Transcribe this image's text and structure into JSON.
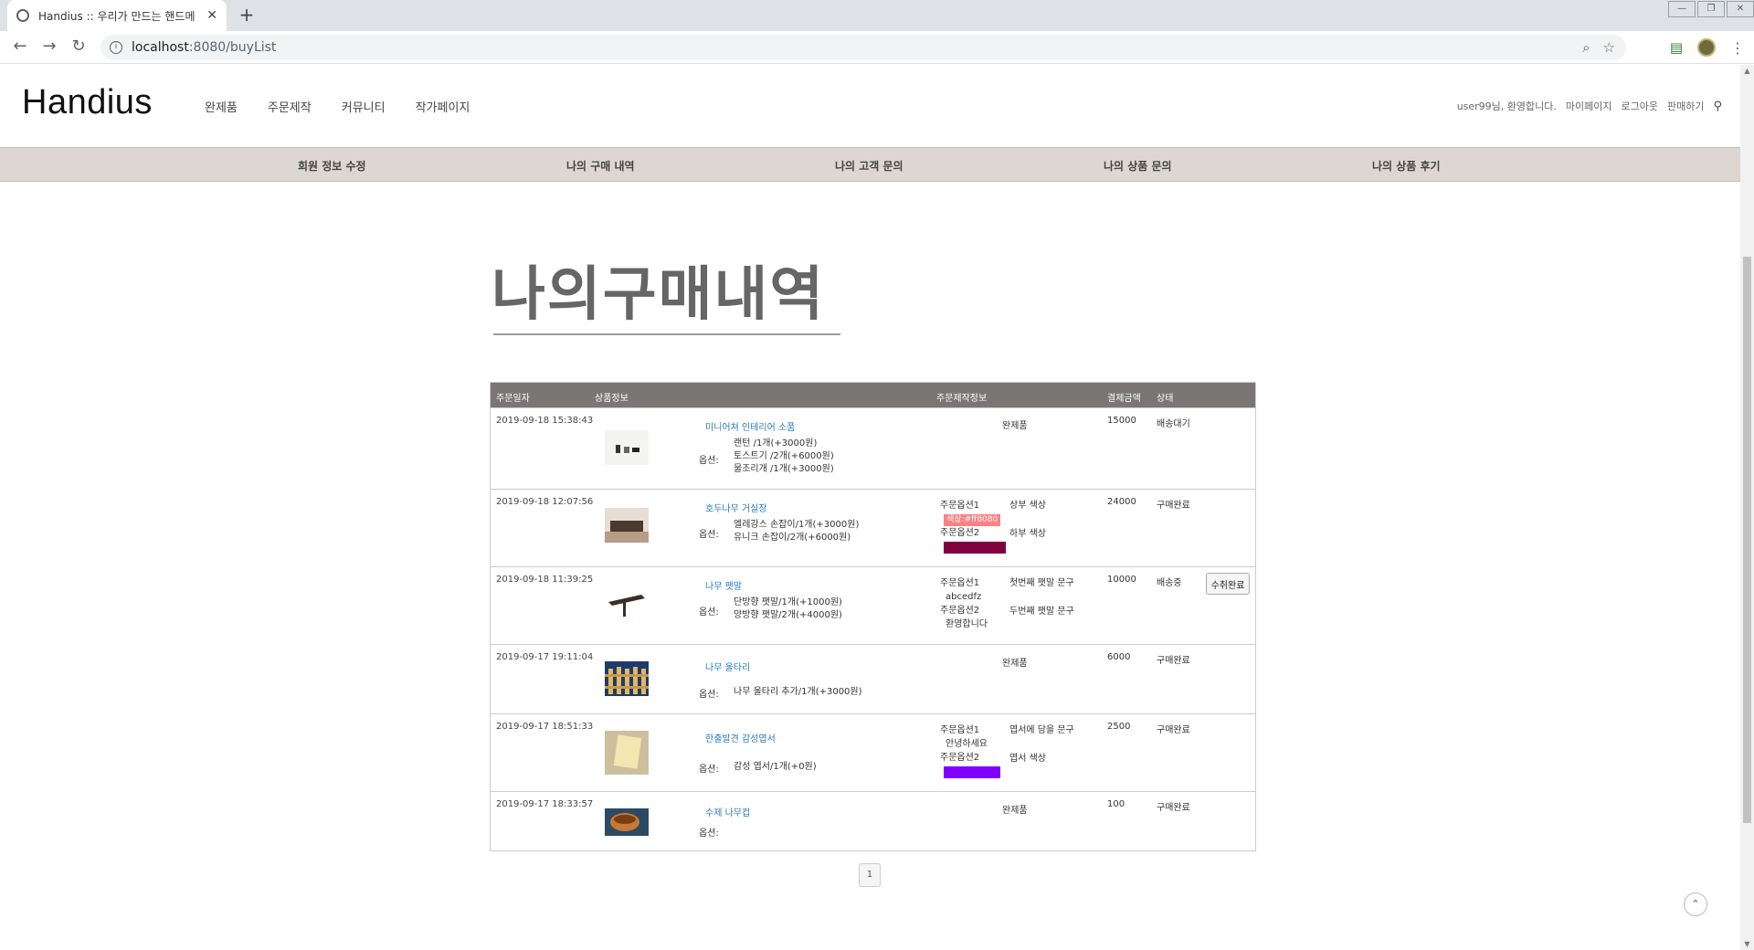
{
  "browser": {
    "tab_title": "Handius :: 우리가 만드는 핸드메",
    "tab_close": "✕",
    "new_tab": "+",
    "url_host": "localhost",
    "url_rest": ":8080/buyList",
    "window_controls": [
      "—",
      "❐",
      "✕"
    ]
  },
  "site": {
    "logo": "Handius",
    "gnb": [
      "완제품",
      "주문제작",
      "커뮤니티",
      "작가페이지"
    ],
    "util": {
      "welcome": "user99님, 환영합니다.",
      "mypage": "마이페이지",
      "logout": "로그아웃",
      "sell": "판매하기"
    },
    "subnav": [
      "회원 정보 수정",
      "나의 구매 내역",
      "나의 고객 문의",
      "나의 상품 문의",
      "나의 상품 후기"
    ]
  },
  "page_title": "나의구매내역",
  "table": {
    "headers": {
      "date": "주문일자",
      "product": "상품정보",
      "custom": "주문제작정보",
      "amount": "결제금액",
      "status": "상태"
    },
    "option_label": "옵션:",
    "rows": [
      {
        "date": "2019-09-18 15:38:43",
        "name": "미니어쳐 인테리어 소품",
        "options": [
          "랜턴 /1개(+3000원)",
          "토스트기 /2개(+6000원)",
          "물조리개 /1개(+3000원)"
        ],
        "custom_text": "완제품",
        "price": "15000",
        "status": "배송대기"
      },
      {
        "date": "2019-09-18 12:07:56",
        "name": "호두나무 거실장",
        "options": [
          "엘레강스 손잡이/1개(+3000원)",
          "유니크 손잡이/2개(+6000원)"
        ],
        "custom": [
          {
            "label": "주문옵션1",
            "value": "색상:#ff8080",
            "swatch": "#ff8080",
            "question": "상부 색상"
          },
          {
            "label": "주문옵션2",
            "value": "색상:#800040",
            "swatch": "#800040",
            "question": "하부 색상"
          }
        ],
        "price": "24000",
        "status": "구매완료"
      },
      {
        "date": "2019-09-18 11:39:25",
        "name": "나무 팻말",
        "options": [
          "단방향 팻말/1개(+1000원)",
          "양방향 팻말/2개(+4000원)"
        ],
        "custom": [
          {
            "label": "주문옵션1",
            "value": "abcedfz",
            "question": "첫번째 팻말 문구"
          },
          {
            "label": "주문옵션2",
            "value": "환영합니다",
            "question": "두번째 팻말 문구"
          }
        ],
        "price": "10000",
        "status": "배송중",
        "button": "수취완료"
      },
      {
        "date": "2019-09-17 19:11:04",
        "name": "나무 울타리",
        "options": [
          "나무 울타리 추가/1개(+3000원)"
        ],
        "custom_text": "완제품",
        "price": "6000",
        "status": "구매완료"
      },
      {
        "date": "2019-09-17 18:51:33",
        "name": "한출발견 감성엽서",
        "options": [
          "감성 엽서/1개(+0원)"
        ],
        "custom": [
          {
            "label": "주문옵션1",
            "value": "안녕하세요",
            "question": "엽서에 담을 문구"
          },
          {
            "label": "주문옵션2",
            "value": "색상:#8000ff",
            "swatch": "#8000ff",
            "question": "엽서 색상"
          }
        ],
        "price": "2500",
        "status": "구매완료"
      },
      {
        "date": "2019-09-17 18:33:57",
        "name": "수제 나무컵",
        "options": [],
        "custom_text": "완제품",
        "price": "100",
        "status": "구매완료"
      }
    ]
  },
  "pagination": [
    "1"
  ],
  "icons": {
    "back": "back-arrow-icon",
    "forward": "forward-arrow-icon",
    "reload": "reload-icon",
    "zoom": "zoom-icon",
    "star": "bookmark-star-icon",
    "search": "search-icon",
    "to_top": "chevron-up-icon"
  }
}
